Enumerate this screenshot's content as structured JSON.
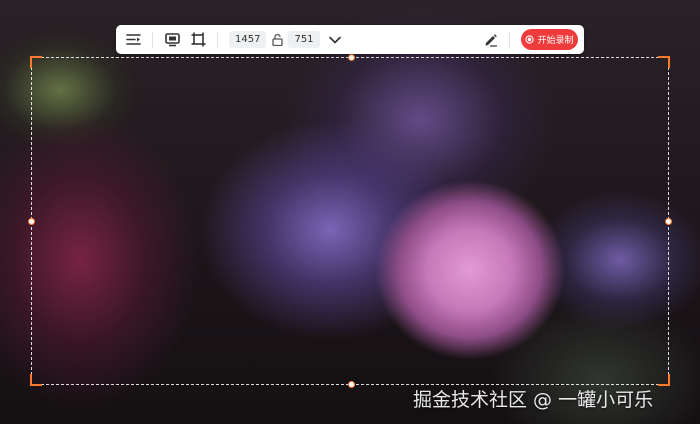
{
  "toolbar": {
    "width_value": "1457",
    "height_value": "751",
    "record_label": "开始录制",
    "icons": [
      "menu-icon",
      "screen-record-icon",
      "crop-area-icon",
      "lock-icon",
      "chevron-down-icon",
      "pen-icon",
      "record-icon"
    ],
    "colors": {
      "record_button": "#ef3b3b",
      "selection_corner": "#ff7a2e"
    }
  },
  "watermark": {
    "text": "掘金技术社区 @ 一罐小可乐"
  }
}
